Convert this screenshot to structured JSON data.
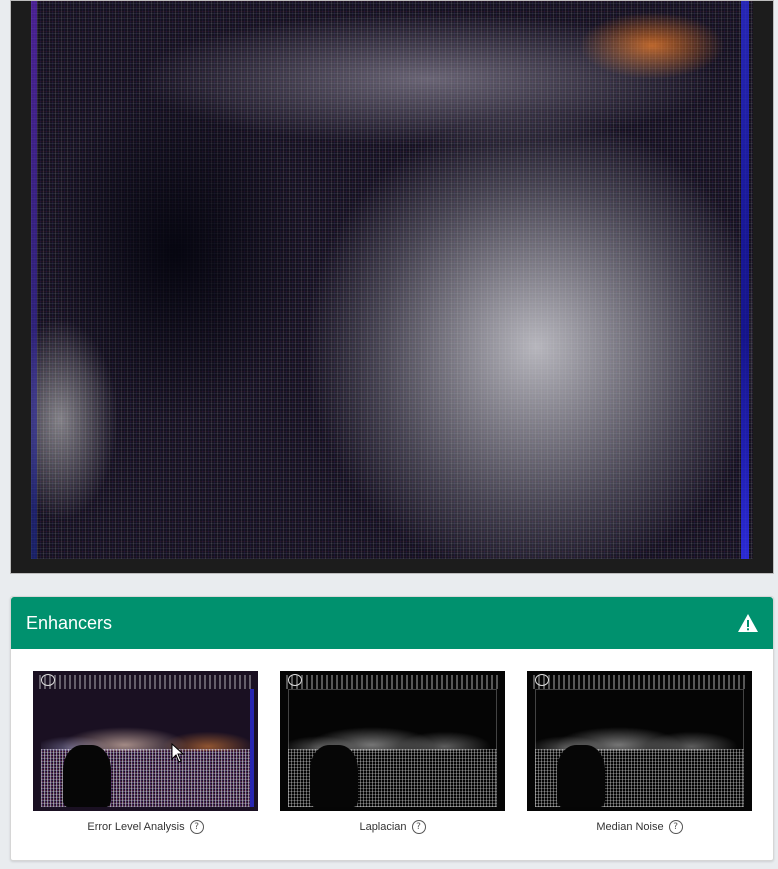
{
  "panel": {
    "title": "Enhancers",
    "warning_icon": "warning-triangle-icon",
    "header_color": "#00916e"
  },
  "thumbnails": [
    {
      "label": "Error Level Analysis",
      "help_icon": "question-circle-icon",
      "help_glyph": "?"
    },
    {
      "label": "Laplacian",
      "help_icon": "question-circle-icon",
      "help_glyph": "?"
    },
    {
      "label": "Median Noise",
      "help_icon": "question-circle-icon",
      "help_glyph": "?"
    }
  ]
}
